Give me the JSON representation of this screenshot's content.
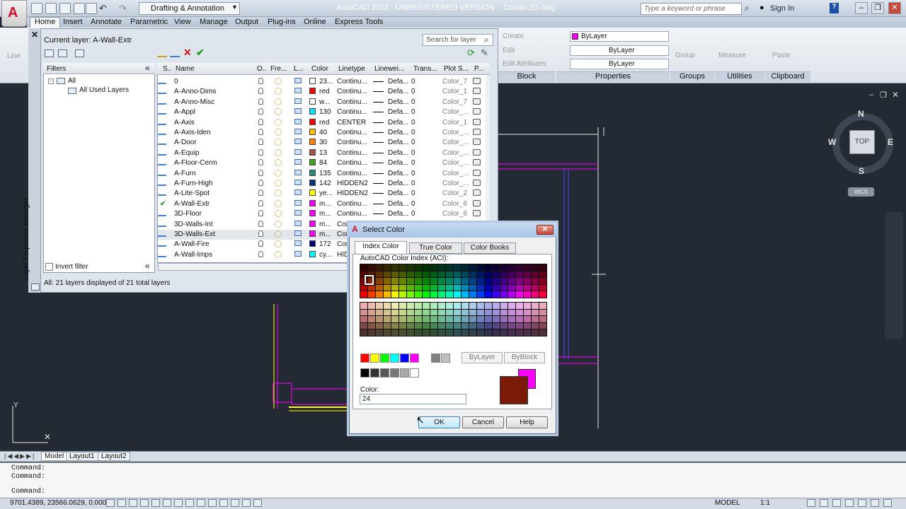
{
  "app": {
    "title": "AutoCAD 2012 - UNREGISTERED VERSION    Condo-2D.dwg",
    "app_letter": "A",
    "workspace": "Drafting & Annotation",
    "search_placeholder": "Type a keyword or phrase",
    "sign_in": "Sign In"
  },
  "menu_tabs": [
    "Home",
    "Insert",
    "Annotate",
    "Parametric",
    "View",
    "Manage",
    "Output",
    "Plug-ins",
    "Online",
    "Express Tools"
  ],
  "ribbon": {
    "block_items": [
      "Create",
      "Edit",
      "Edit Attributes"
    ],
    "block_title": "Block",
    "properties": {
      "color": "ByLayer",
      "linetype": "ByLayer",
      "lineweight": "ByLayer",
      "title": "Properties"
    },
    "groups": {
      "label": "Group",
      "title": "Groups"
    },
    "utilities": {
      "label": "Measure",
      "title": "Utilities"
    },
    "clipboard": {
      "label": "Paste",
      "title": "Clipboard"
    },
    "draw_label": "Line"
  },
  "layer_palette": {
    "current_layer": "Current layer: A-Wall-Extr",
    "search_placeholder": "Search for layer",
    "filters_header": "Filters",
    "tree_all": "All",
    "tree_used": "All Used Layers",
    "invert_filter": "Invert filter",
    "status": "All: 21 layers displayed of 21 total layers",
    "side_title": "Layer Properties Manager",
    "columns": [
      "S..",
      "Name",
      "O..",
      "Fre...",
      "L...",
      "Color",
      "Linetype",
      "Linewei...",
      "Trans...",
      "Plot S...",
      "P..."
    ],
    "rows": [
      {
        "name": "0",
        "color_name": "23...",
        "swatch": "#ffffff",
        "linetype": "Continu...",
        "lineweight": "Defa...",
        "trans": "0",
        "plot": "Color_7"
      },
      {
        "name": "A-Anno-Dims",
        "color_name": "red",
        "swatch": "#ff0000",
        "linetype": "Continu...",
        "lineweight": "Defa...",
        "trans": "0",
        "plot": "Color_1"
      },
      {
        "name": "A-Anno-Misc",
        "color_name": "w...",
        "swatch": "#ffffff",
        "linetype": "Continu...",
        "lineweight": "Defa...",
        "trans": "0",
        "plot": "Color_7"
      },
      {
        "name": "A-Appl",
        "color_name": "130",
        "swatch": "#00e5ff",
        "linetype": "Continu...",
        "lineweight": "Defa...",
        "trans": "0",
        "plot": "Color_..."
      },
      {
        "name": "A-Axis",
        "color_name": "red",
        "swatch": "#ff0000",
        "linetype": "CENTER",
        "lineweight": "Defa...",
        "trans": "0",
        "plot": "Color_1"
      },
      {
        "name": "A-Axis-Iden",
        "color_name": "40",
        "swatch": "#ffbf00",
        "linetype": "Continu...",
        "lineweight": "Defa...",
        "trans": "0",
        "plot": "Color_..."
      },
      {
        "name": "A-Door",
        "color_name": "30",
        "swatch": "#ff7f00",
        "linetype": "Continu...",
        "lineweight": "Defa...",
        "trans": "0",
        "plot": "Color_..."
      },
      {
        "name": "A-Equip",
        "color_name": "13",
        "swatch": "#a5524a",
        "linetype": "Continu...",
        "lineweight": "Defa...",
        "trans": "0",
        "plot": "Color_..."
      },
      {
        "name": "A-Floor-Cerm",
        "color_name": "84",
        "swatch": "#3f9f1f",
        "linetype": "Continu...",
        "lineweight": "Defa...",
        "trans": "0",
        "plot": "Color_..."
      },
      {
        "name": "A-Furn",
        "color_name": "135",
        "swatch": "#2a8c7f",
        "linetype": "Continu...",
        "lineweight": "Defa...",
        "trans": "0",
        "plot": "Color_..."
      },
      {
        "name": "A-Furn-High",
        "color_name": "142",
        "swatch": "#00337f",
        "linetype": "HIDDEN2",
        "lineweight": "Defa...",
        "trans": "0",
        "plot": "Color_..."
      },
      {
        "name": "A-Lite-Spot",
        "color_name": "ye...",
        "swatch": "#ffff00",
        "linetype": "HIDDEN2",
        "lineweight": "Defa...",
        "trans": "0",
        "plot": "Color_2"
      },
      {
        "name": "A-Wall-Extr",
        "color_name": "m...",
        "swatch": "#ff00ff",
        "linetype": "Continu...",
        "lineweight": "Defa...",
        "trans": "0",
        "plot": "Color_6"
      },
      {
        "name": "3D-Floor",
        "color_name": "m...",
        "swatch": "#ff00ff",
        "linetype": "Continu...",
        "lineweight": "Defa...",
        "trans": "0",
        "plot": "Color_6"
      },
      {
        "name": "3D-Walls-Int",
        "color_name": "m...",
        "swatch": "#ff00ff",
        "linetype": "Con",
        "lineweight": "",
        "trans": "",
        "plot": ""
      },
      {
        "name": "3D-Walls-Ext",
        "color_name": "m...",
        "swatch": "#ff00ff",
        "linetype": "Con",
        "lineweight": "",
        "trans": "",
        "plot": ""
      },
      {
        "name": "A-Wall-Fire",
        "color_name": "172",
        "swatch": "#00007f",
        "linetype": "Con",
        "lineweight": "",
        "trans": "",
        "plot": ""
      },
      {
        "name": "A-Wall-Imps",
        "color_name": "cy...",
        "swatch": "#00ffff",
        "linetype": "HID",
        "lineweight": "",
        "trans": "",
        "plot": ""
      }
    ]
  },
  "dialog": {
    "title": "Select Color",
    "tabs": [
      "Index Color",
      "True Color",
      "Color Books"
    ],
    "aci_label": "AutoCAD Color Index (ACI):",
    "bylayer": "ByLayer",
    "byblock": "ByBlock",
    "color_label": "Color:",
    "color_value": "24",
    "buttons": {
      "ok": "OK",
      "cancel": "Cancel",
      "help": "Help"
    },
    "new_color": "#7b1a06",
    "old_color": "#ff00ff"
  },
  "viewcube": {
    "n": "N",
    "s": "S",
    "e": "E",
    "w": "W",
    "top": "TOP",
    "wcs": "WCS"
  },
  "layout_tabs": [
    "Model",
    "Layout1",
    "Layout2"
  ],
  "command": {
    "line1": "Command:",
    "line2": "Command:",
    "line3": "Command:"
  },
  "status": {
    "coords": "9701.4389, 23566.0629, 0.0000",
    "model": "MODEL",
    "scale": "1:1"
  }
}
